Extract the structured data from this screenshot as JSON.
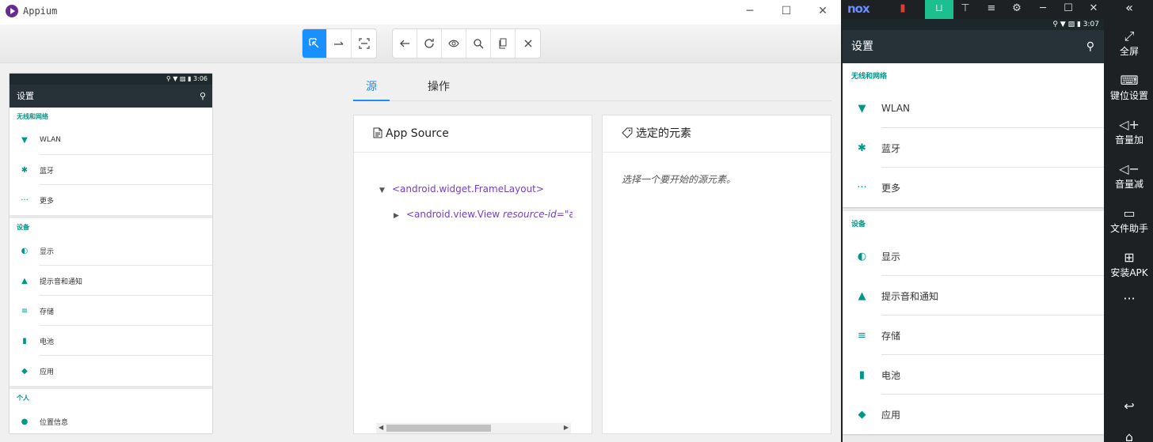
{
  "appium": {
    "title": "Appium",
    "window_controls": {
      "minimize": "─",
      "maximize": "☐",
      "close": "✕"
    },
    "tabs": [
      "源",
      "操作"
    ],
    "source_panel": {
      "title": "App Source",
      "tree": [
        {
          "tag_open": "<android.widget.FrameLayout>"
        },
        {
          "tag_open": "<android.view.View ",
          "attr_name": "resource-id",
          "attr_rest": "=\"andro"
        }
      ]
    },
    "selected_panel": {
      "title": "选定的元素",
      "hint": "选择一个要开始的源元素。"
    },
    "preview": {
      "time": "3:06",
      "status_icons": "⚲ ▼ ▨ ▮",
      "header": "设置",
      "sections": [
        {
          "title": "无线和网络",
          "items": [
            {
              "icon": "▼",
              "label": "WLAN"
            },
            {
              "icon": "✱",
              "label": "蓝牙"
            },
            {
              "icon": "···",
              "label": "更多"
            }
          ]
        },
        {
          "title": "设备",
          "items": [
            {
              "icon": "◐",
              "label": "显示"
            },
            {
              "icon": "▲",
              "label": "提示音和通知"
            },
            {
              "icon": "≡",
              "label": "存储"
            },
            {
              "icon": "▮",
              "label": "电池"
            },
            {
              "icon": "◆",
              "label": "应用"
            }
          ]
        },
        {
          "title": "个人",
          "items": [
            {
              "icon": "●",
              "label": "位置信息"
            }
          ]
        }
      ]
    }
  },
  "nox": {
    "logo": "nox",
    "time": "3:07",
    "status_icons": "⚲ ▼ ▨ ▮",
    "header": "设置",
    "sections": [
      {
        "title": "无线和网络",
        "items": [
          {
            "icon": "▼",
            "label": "WLAN"
          },
          {
            "icon": "✱",
            "label": "蓝牙"
          },
          {
            "icon": "···",
            "label": "更多"
          }
        ]
      },
      {
        "title": "设备",
        "items": [
          {
            "icon": "◐",
            "label": "显示"
          },
          {
            "icon": "▲",
            "label": "提示音和通知"
          },
          {
            "icon": "≡",
            "label": "存储"
          },
          {
            "icon": "▮",
            "label": "电池"
          },
          {
            "icon": "◆",
            "label": "应用"
          }
        ]
      }
    ],
    "sidebar": {
      "fullscreen": "全屏",
      "keymap": "键位设置",
      "volume_up": "音量加",
      "volume_down": "音量减",
      "file_helper": "文件助手",
      "install_apk": "安装APK",
      "more": "···"
    }
  }
}
